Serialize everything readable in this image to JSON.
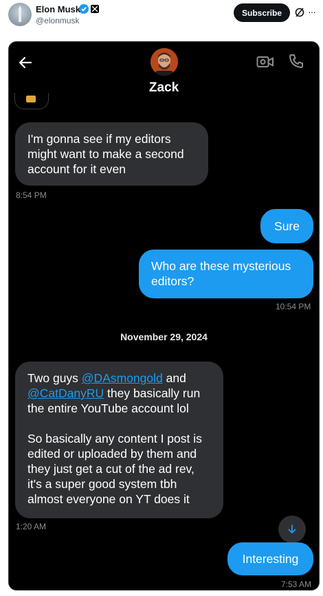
{
  "tweet": {
    "author_name": "Elon Musk",
    "author_handle": "@elonmusk",
    "subscribe_label": "Subscribe",
    "more_label": "···"
  },
  "chat": {
    "contact_name": "Zack",
    "date_separator": "November 29, 2024",
    "messages": [
      {
        "direction": "in",
        "text": "I'm gonna see if my editors might want to make a second account for it even",
        "time": "8:54 PM"
      },
      {
        "direction": "out",
        "text": "Sure",
        "time": ""
      },
      {
        "direction": "out",
        "text": "Who are these mysterious editors?",
        "time": "10:54 PM"
      },
      {
        "direction": "in",
        "text_part1": "Two guys ",
        "mention1": "@DAsmongold",
        "text_part2": " and ",
        "mention2": "@CatDanyRU",
        "text_part3": " they basically run the entire YouTube account lol",
        "text_part4": "So basically any content I post is edited or uploaded by them and they just get a cut of the ad rev, it's a super good system tbh almost everyone on YT does it",
        "time": "1:20 AM"
      },
      {
        "direction": "out",
        "text": "Interesting",
        "time": "7:53 AM"
      }
    ]
  },
  "colors": {
    "accent": "#1d9bf0",
    "incoming_bubble": "#2f3033",
    "background": "#000000"
  },
  "icons": [
    "back-arrow-icon",
    "video-call-icon",
    "phone-icon",
    "verified-badge-icon",
    "x-logo-icon",
    "grok-icon",
    "scroll-down-icon"
  ]
}
